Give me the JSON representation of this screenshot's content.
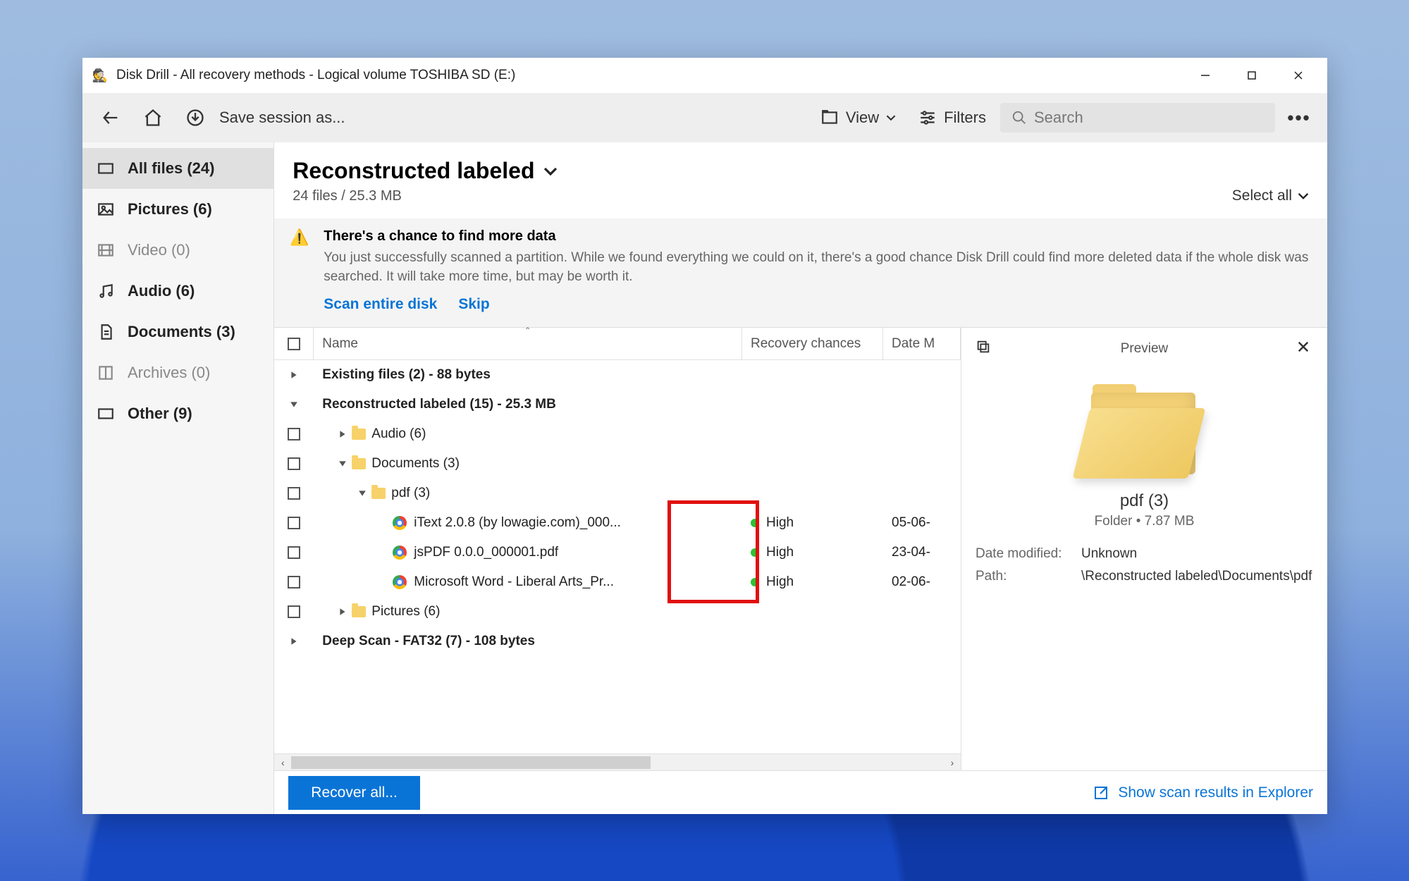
{
  "titlebar": {
    "title": "Disk Drill - All recovery methods - Logical volume TOSHIBA SD (E:)"
  },
  "toolbar": {
    "save_session": "Save session as...",
    "view_label": "View",
    "filters_label": "Filters",
    "search_placeholder": "Search"
  },
  "sidebar": {
    "items": [
      {
        "label": "All files (24)",
        "dim": false,
        "selected": true
      },
      {
        "label": "Pictures (6)",
        "dim": false,
        "selected": false
      },
      {
        "label": "Video (0)",
        "dim": true,
        "selected": false
      },
      {
        "label": "Audio (6)",
        "dim": false,
        "selected": false
      },
      {
        "label": "Documents (3)",
        "dim": false,
        "selected": false
      },
      {
        "label": "Archives (0)",
        "dim": true,
        "selected": false
      },
      {
        "label": "Other (9)",
        "dim": false,
        "selected": false
      }
    ]
  },
  "main": {
    "heading": "Reconstructed labeled",
    "subheading": "24 files / 25.3 MB",
    "select_all": "Select all"
  },
  "notice": {
    "title": "There's a chance to find more data",
    "text": "You just successfully scanned a partition. While we found everything we could on it, there's a good chance Disk Drill could find more deleted data if the whole disk was searched. It will take more time, but may be worth it.",
    "action_scan": "Scan entire disk",
    "action_skip": "Skip"
  },
  "columns": {
    "name": "Name",
    "recovery": "Recovery chances",
    "date": "Date M"
  },
  "groups": {
    "existing": "Existing files (2) - 88 bytes",
    "reconstructed": "Reconstructed labeled (15) - 25.3 MB",
    "audio": "Audio (6)",
    "documents": "Documents (3)",
    "pdf": "pdf (3)",
    "pictures": "Pictures (6)",
    "deep": "Deep Scan - FAT32 (7) - 108 bytes"
  },
  "files": [
    {
      "name": "iText 2.0.8 (by lowagie.com)_000...",
      "recovery": "High",
      "date": "05-06-"
    },
    {
      "name": "jsPDF 0.0.0_000001.pdf",
      "recovery": "High",
      "date": "23-04-"
    },
    {
      "name": "Microsoft Word - Liberal Arts_Pr...",
      "recovery": "High",
      "date": "02-06-"
    }
  ],
  "preview": {
    "header": "Preview",
    "name": "pdf (3)",
    "meta": "Folder • 7.87 MB",
    "kv": {
      "date_modified_label": "Date modified:",
      "date_modified_value": "Unknown",
      "path_label": "Path:",
      "path_value": "\\Reconstructed labeled\\Documents\\pdf"
    }
  },
  "footer": {
    "recover": "Recover all...",
    "show_link": "Show scan results in Explorer"
  }
}
